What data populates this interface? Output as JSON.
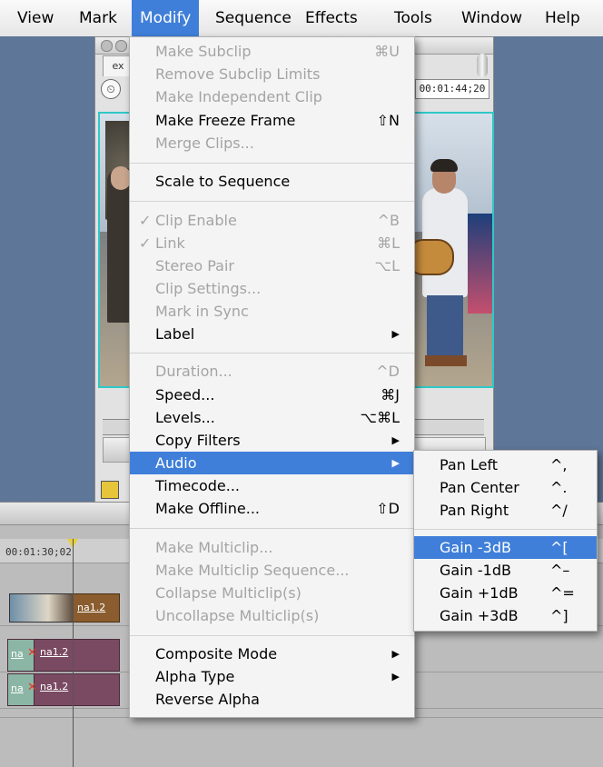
{
  "menubar": {
    "items": [
      {
        "label": "View"
      },
      {
        "label": "Mark"
      },
      {
        "label": "Modify"
      },
      {
        "label": "Sequence"
      },
      {
        "label": "Effects"
      },
      {
        "label": "Tools"
      },
      {
        "label": "Window"
      },
      {
        "label": "Help"
      }
    ],
    "active_index": 2,
    "highlight_color": "#3f7fd9"
  },
  "viewer": {
    "tab_label": "ex",
    "timecode": "00:01:44;20"
  },
  "timeline": {
    "ruler_timecode": "00:01:30;02",
    "video_clip_label": "na1.2",
    "audio_track_1": {
      "left_label": "na",
      "clip_label": "na1.2"
    },
    "audio_track_2": {
      "left_label": "na",
      "clip_label": "na1.2"
    }
  },
  "modify_menu": {
    "items": [
      {
        "label": "Make Subclip",
        "shortcut": "⌘U",
        "enabled": false
      },
      {
        "label": "Remove Subclip Limits",
        "shortcut": "",
        "enabled": false
      },
      {
        "label": "Make Independent Clip",
        "shortcut": "",
        "enabled": false
      },
      {
        "label": "Make Freeze Frame",
        "shortcut": "⇧N",
        "enabled": true
      },
      {
        "label": "Merge Clips...",
        "shortcut": "",
        "enabled": false
      },
      {
        "label": "Scale to Sequence",
        "shortcut": "",
        "enabled": true
      },
      {
        "label": "Clip Enable",
        "shortcut": "^B",
        "enabled": false,
        "checked": true
      },
      {
        "label": "Link",
        "shortcut": "⌘L",
        "enabled": false,
        "checked": true
      },
      {
        "label": "Stereo Pair",
        "shortcut": "⌥L",
        "enabled": false
      },
      {
        "label": "Clip Settings...",
        "shortcut": "",
        "enabled": false
      },
      {
        "label": "Mark in Sync",
        "shortcut": "",
        "enabled": false
      },
      {
        "label": "Label",
        "shortcut": "",
        "enabled": true,
        "submenu": true
      },
      {
        "label": "Duration...",
        "shortcut": "^D",
        "enabled": false
      },
      {
        "label": "Speed...",
        "shortcut": "⌘J",
        "enabled": true
      },
      {
        "label": "Levels...",
        "shortcut": "⌥⌘L",
        "enabled": true
      },
      {
        "label": "Copy Filters",
        "shortcut": "",
        "enabled": true,
        "submenu": true
      },
      {
        "label": "Audio",
        "shortcut": "",
        "enabled": true,
        "submenu": true,
        "highlighted": true
      },
      {
        "label": "Timecode...",
        "shortcut": "",
        "enabled": true
      },
      {
        "label": "Make Offline...",
        "shortcut": "⇧D",
        "enabled": true
      },
      {
        "label": "Make Multiclip...",
        "shortcut": "",
        "enabled": false
      },
      {
        "label": "Make Multiclip Sequence...",
        "shortcut": "",
        "enabled": false
      },
      {
        "label": "Collapse Multiclip(s)",
        "shortcut": "",
        "enabled": false
      },
      {
        "label": "Uncollapse Multiclip(s)",
        "shortcut": "",
        "enabled": false
      },
      {
        "label": "Composite Mode",
        "shortcut": "",
        "enabled": true,
        "submenu": true
      },
      {
        "label": "Alpha Type",
        "shortcut": "",
        "enabled": true,
        "submenu": true
      },
      {
        "label": "Reverse Alpha",
        "shortcut": "",
        "enabled": true
      }
    ],
    "check_glyph": "✓",
    "submenu_glyph": "▶"
  },
  "audio_menu": {
    "items": [
      {
        "label": "Pan Left",
        "shortcut": "^,"
      },
      {
        "label": "Pan Center",
        "shortcut": "^."
      },
      {
        "label": "Pan Right",
        "shortcut": "^/"
      },
      {
        "label": "Gain -3dB",
        "shortcut": "^[",
        "highlighted": true
      },
      {
        "label": "Gain -1dB",
        "shortcut": "^–"
      },
      {
        "label": "Gain +1dB",
        "shortcut": "^="
      },
      {
        "label": "Gain +3dB",
        "shortcut": "^]"
      }
    ]
  }
}
